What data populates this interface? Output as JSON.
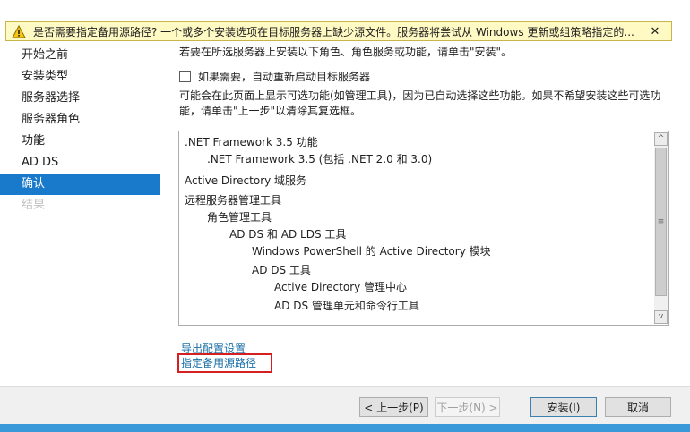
{
  "warning": {
    "text": "是否需要指定备用源路径? 一个或多个安装选项在目标服务器上缺少源文件。服务器将尝试从 Windows 更新或组策略指定的...",
    "close_glyph": "✕"
  },
  "sidebar": {
    "items": [
      {
        "label": "开始之前"
      },
      {
        "label": "安装类型"
      },
      {
        "label": "服务器选择"
      },
      {
        "label": "服务器角色"
      },
      {
        "label": "功能"
      },
      {
        "label": "AD DS"
      },
      {
        "label": "确认"
      },
      {
        "label": "结果"
      }
    ]
  },
  "main": {
    "description": "若要在所选服务器上安装以下角色、角色服务或功能，请单击\"安装\"。",
    "restart_checkbox_label": "如果需要，自动重新启动目标服务器",
    "restart_checked": false,
    "info_line1": "可能会在此页面上显示可选功能(如管理工具)，因为已自动选择这些功能。如果不希望安装这些可选功",
    "info_line2": "能，请单击\"上一步\"以清除其复选框。",
    "features": [
      ".NET Framework 3.5 功能",
      ".NET Framework 3.5 (包括 .NET 2.0 和 3.0)",
      "Active Directory 域服务",
      "远程服务器管理工具",
      "角色管理工具",
      "AD DS 和 AD LDS 工具",
      "Windows PowerShell 的 Active Directory 模块",
      "AD DS 工具",
      "Active Directory 管理中心",
      "AD DS 管理单元和命令行工具"
    ],
    "scroll_up": "^",
    "scroll_down": "v",
    "scroll_grip": "≡",
    "export_link": "导出配置设置",
    "alt_source_link": "指定备用源路径"
  },
  "footer": {
    "prev_label": "< 上一步(P)",
    "next_label": "下一步(N) >",
    "install_label": "安装(I)",
    "cancel_label": "取消"
  },
  "colors": {
    "accent": "#1979ca",
    "warning_bg": "#fff9c4",
    "link": "#1a6fa8",
    "highlight": "#d42020"
  }
}
